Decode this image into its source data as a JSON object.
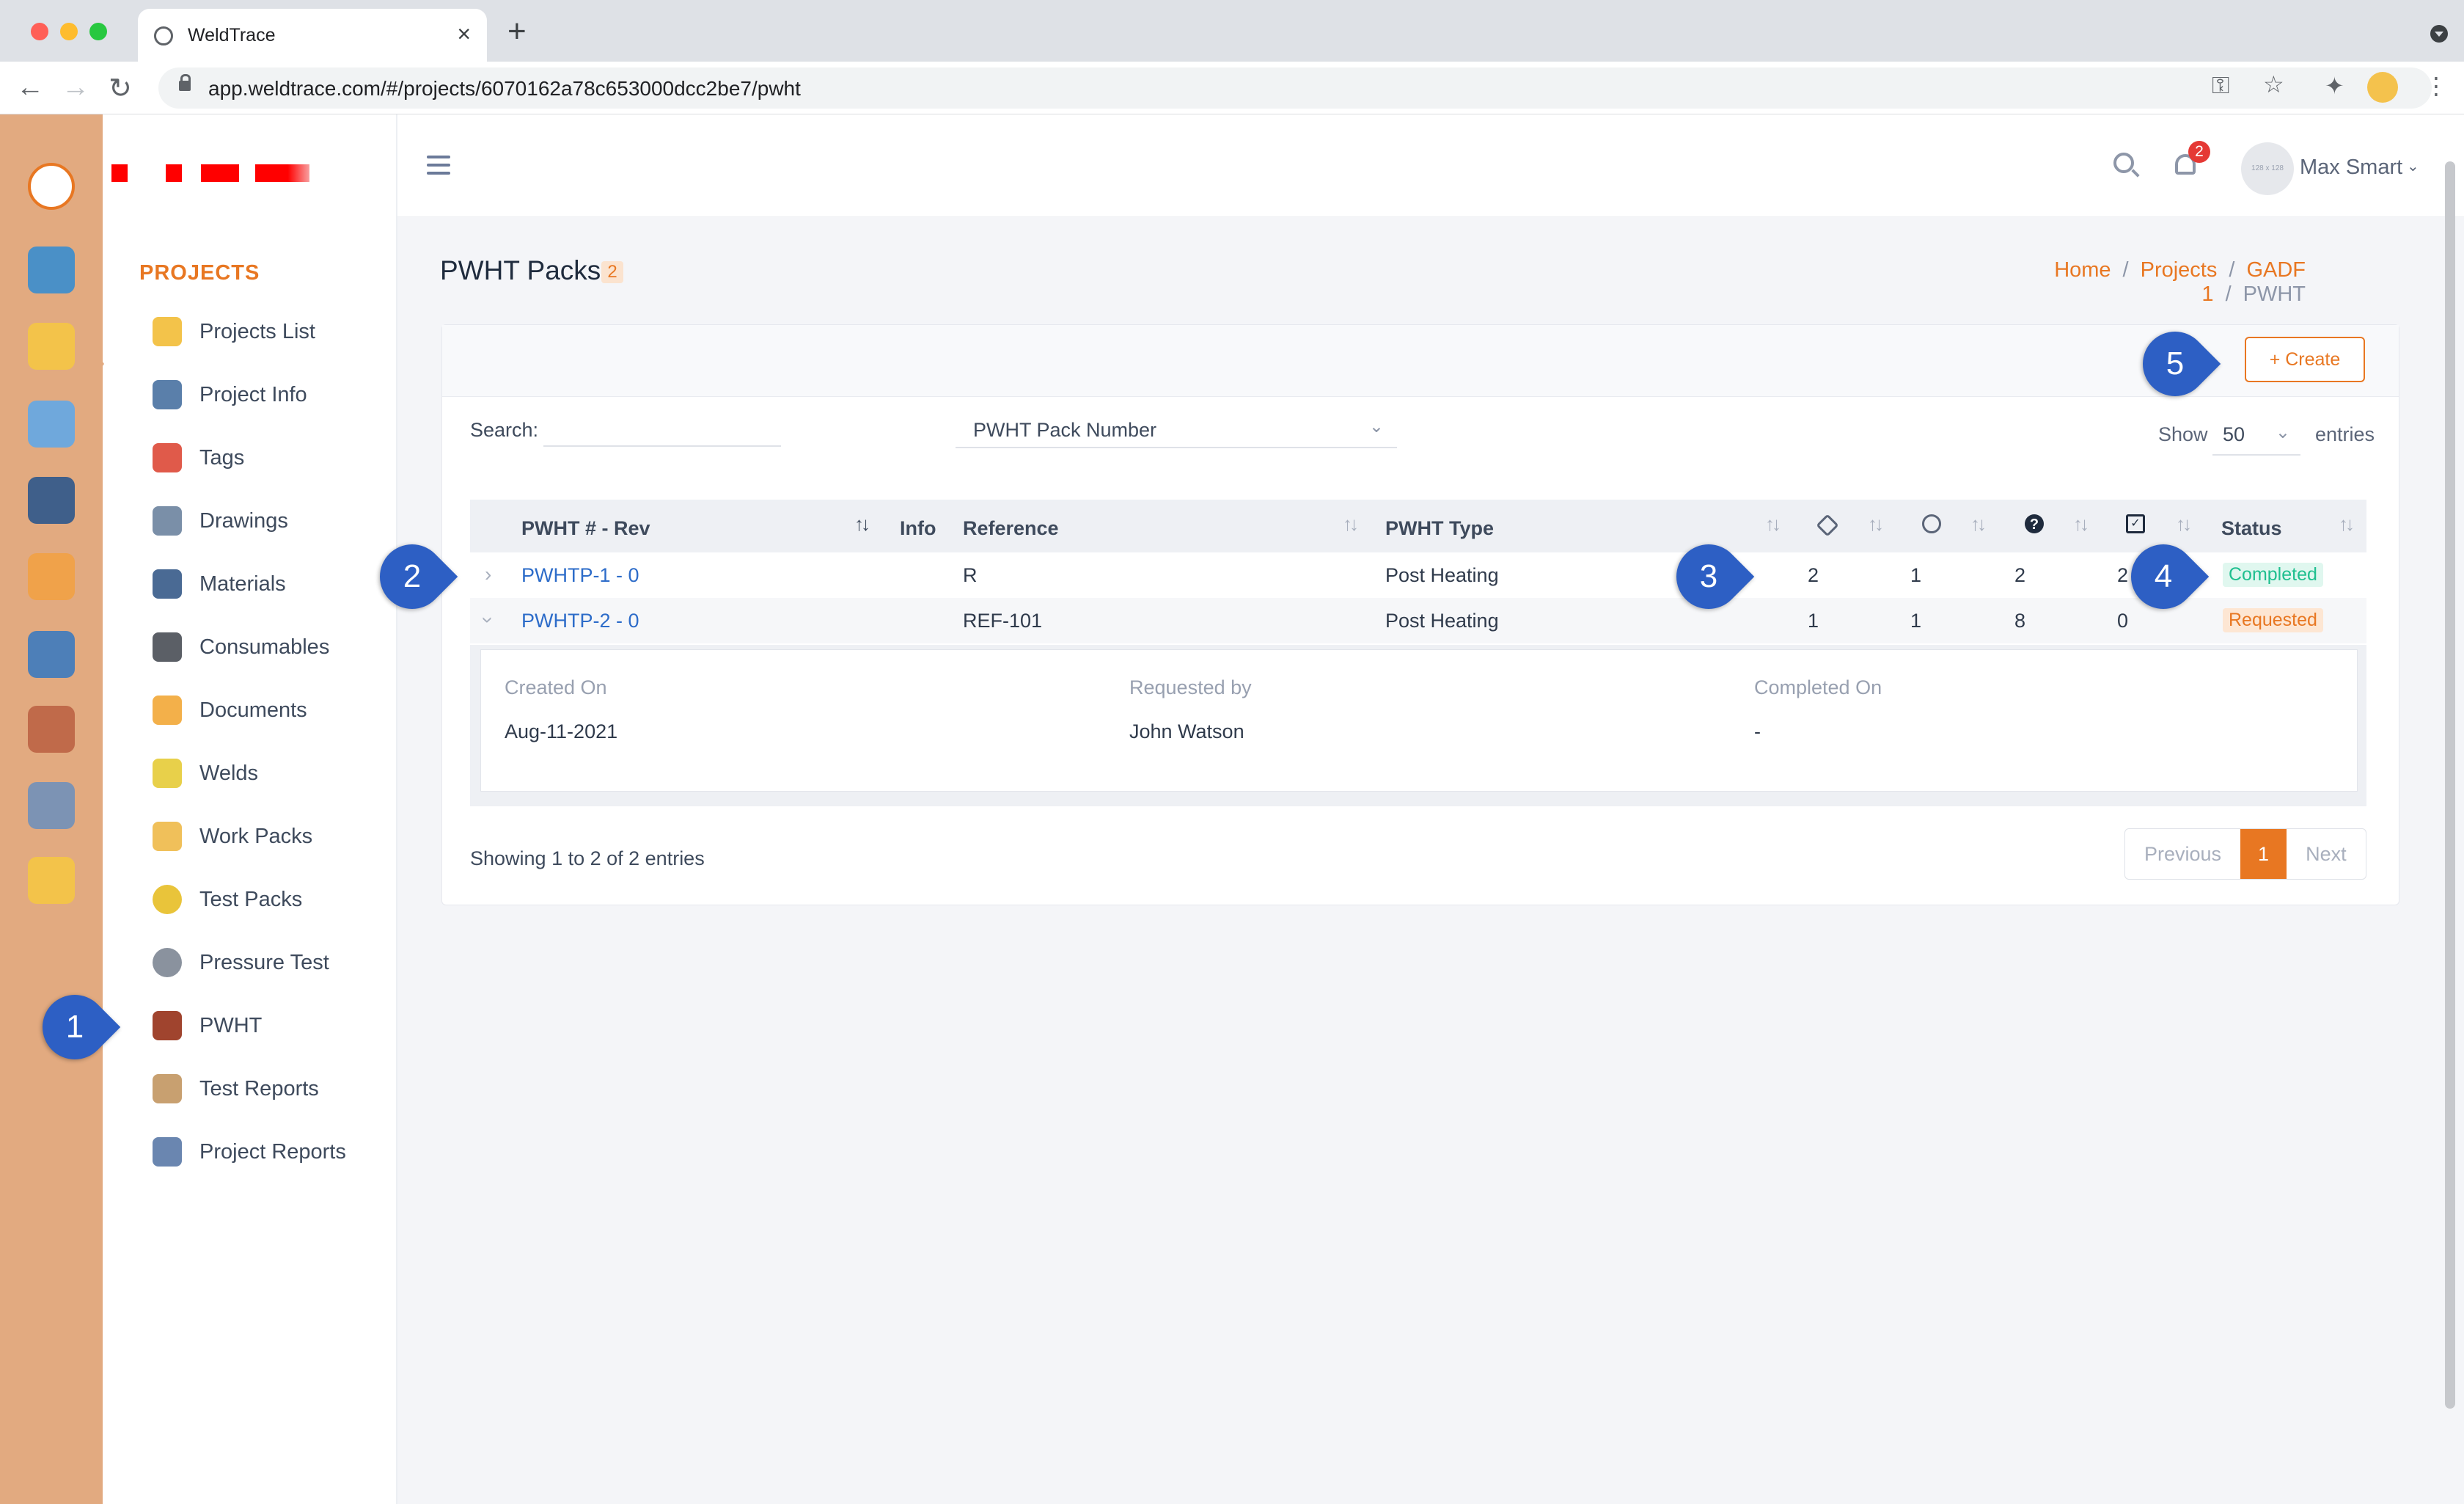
{
  "browser": {
    "tab_title": "WeldTrace",
    "url": "app.weldtrace.com/#/projects/6070162a78c653000dcc2be7/pwht"
  },
  "sidebar": {
    "section_title": "PROJECTS",
    "items": [
      {
        "label": "Projects List",
        "icon": "camera-folder-icon"
      },
      {
        "label": "Project Info",
        "icon": "gears-icon"
      },
      {
        "label": "Tags",
        "icon": "tag-icon"
      },
      {
        "label": "Drawings",
        "icon": "drawing-tools-icon"
      },
      {
        "label": "Materials",
        "icon": "pipes-icon"
      },
      {
        "label": "Consumables",
        "icon": "rod-stack-icon"
      },
      {
        "label": "Documents",
        "icon": "folder-icon"
      },
      {
        "label": "Welds",
        "icon": "weld-spark-icon"
      },
      {
        "label": "Work Packs",
        "icon": "box-icon"
      },
      {
        "label": "Test Packs",
        "icon": "radiation-icon"
      },
      {
        "label": "Pressure Test",
        "icon": "gauge-icon"
      },
      {
        "label": "PWHT",
        "icon": "heater-icon"
      },
      {
        "label": "Test Reports",
        "icon": "checklist-icon"
      },
      {
        "label": "Project Reports",
        "icon": "report-icon"
      }
    ]
  },
  "header": {
    "notification_count": "2",
    "avatar_text": "128 x 128",
    "user_name": "Max Smart"
  },
  "page": {
    "title": "PWHT Packs",
    "count": "2",
    "breadcrumb": [
      "Home",
      "Projects",
      "GADF 1",
      "PWHT"
    ]
  },
  "toolbar": {
    "create_label": "+ Create",
    "search_label": "Search:",
    "search_value": "",
    "filter_value": "PWHT Pack Number",
    "show_label": "Show",
    "show_value": "50",
    "entries_label": "entries"
  },
  "table": {
    "columns": [
      "PWHT # - Rev",
      "Info",
      "Reference",
      "PWHT Type",
      "tags-icon",
      "welds-icon",
      "question-icon",
      "calendar-check-icon",
      "Status"
    ],
    "rows": [
      {
        "number": "PWHTP-1 - 0",
        "reference": "R",
        "type": "Post Heating",
        "c1": "2",
        "c2": "1",
        "c3": "2",
        "c4": "2",
        "status": "Completed"
      },
      {
        "number": "PWHTP-2 - 0",
        "reference": "REF-101",
        "type": "Post Heating",
        "c1": "1",
        "c2": "1",
        "c3": "8",
        "c4": "0",
        "status": "Requested"
      }
    ],
    "detail": {
      "created_on_label": "Created On",
      "created_on": "Aug-11-2021",
      "requested_by_label": "Requested by",
      "requested_by": "John Watson",
      "completed_on_label": "Completed On",
      "completed_on": "-"
    }
  },
  "footer": {
    "showing": "Showing 1 to 2 of 2 entries",
    "prev": "Previous",
    "page": "1",
    "next": "Next"
  },
  "callouts": [
    "1",
    "2",
    "3",
    "4",
    "5"
  ],
  "colors": {
    "accent": "#e87722",
    "rail": "#e2aa80",
    "link": "#2d6cc9",
    "callout": "#2d5fc4",
    "completed": "#1fbf8f",
    "requested": "#e87722"
  }
}
